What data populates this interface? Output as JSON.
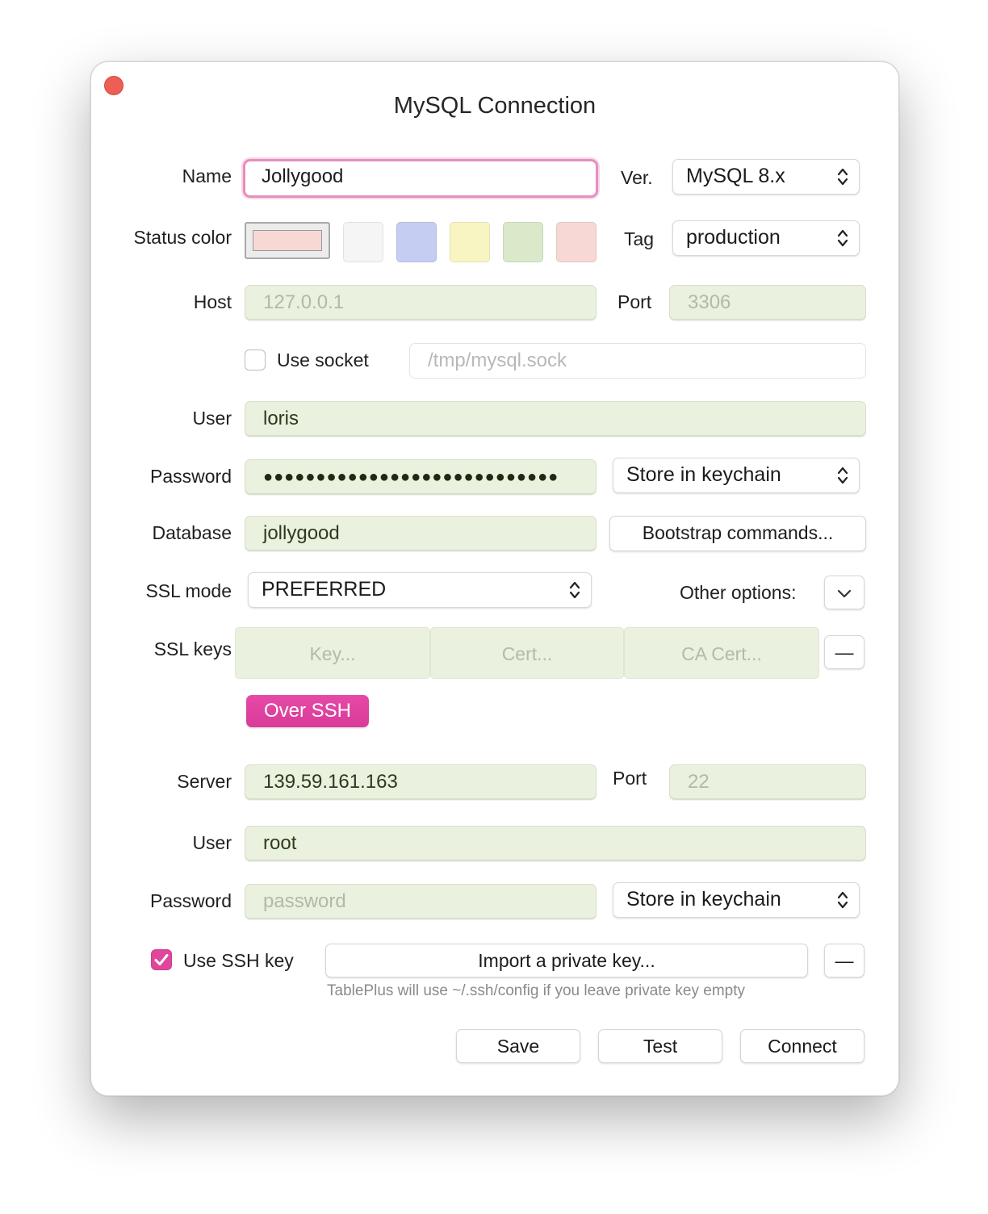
{
  "window": {
    "title": "MySQL Connection"
  },
  "labels": {
    "name": "Name",
    "version": "Ver.",
    "status_color": "Status color",
    "tag": "Tag",
    "host": "Host",
    "port": "Port",
    "use_socket": "Use socket",
    "user": "User",
    "password": "Password",
    "database": "Database",
    "ssl_mode": "SSL mode",
    "other_options": "Other options:",
    "ssl_keys": "SSL keys"
  },
  "fields": {
    "name": "Jollygood",
    "version": "MySQL 8.x",
    "tag": "production",
    "host_placeholder": "127.0.0.1",
    "port_placeholder": "3306",
    "socket_placeholder": "/tmp/mysql.sock",
    "use_socket_checked": false,
    "user": "loris",
    "password_mask": "●●●●●●●●●●●●●●●●●●●●●●●●●●●●",
    "password_storage": "Store in keychain",
    "database": "jollygood",
    "bootstrap_button": "Bootstrap commands...",
    "ssl_mode": "PREFERRED",
    "ssl_key_button": "Key...",
    "ssl_cert_button": "Cert...",
    "ssl_ca_cert_button": "CA Cert...",
    "ssl_remove_button": "—"
  },
  "status_colors": {
    "selected": "#f8d8d5",
    "options": [
      "#f5f5f5",
      "#c5cdf3",
      "#f8f5c3",
      "#dbe9cb",
      "#f8d8d5"
    ]
  },
  "ssh": {
    "toggle_label": "Over SSH",
    "server_label": "Server",
    "server": "139.59.161.163",
    "port_label": "Port",
    "port_placeholder": "22",
    "user_label": "User",
    "user": "root",
    "password_label": "Password",
    "password_placeholder": "password",
    "password_storage": "Store in keychain",
    "use_ssh_key_label": "Use SSH key",
    "use_ssh_key_checked": true,
    "import_key_button": "Import a private key...",
    "remove_key_button": "—",
    "hint": "TablePlus will use ~/.ssh/config if you leave private key empty"
  },
  "actions": {
    "save": "Save",
    "test": "Test",
    "connect": "Connect"
  },
  "colors": {
    "accent": "#e0479c",
    "field_bg": "#eaf1de",
    "close_button": "#ec5f54"
  }
}
